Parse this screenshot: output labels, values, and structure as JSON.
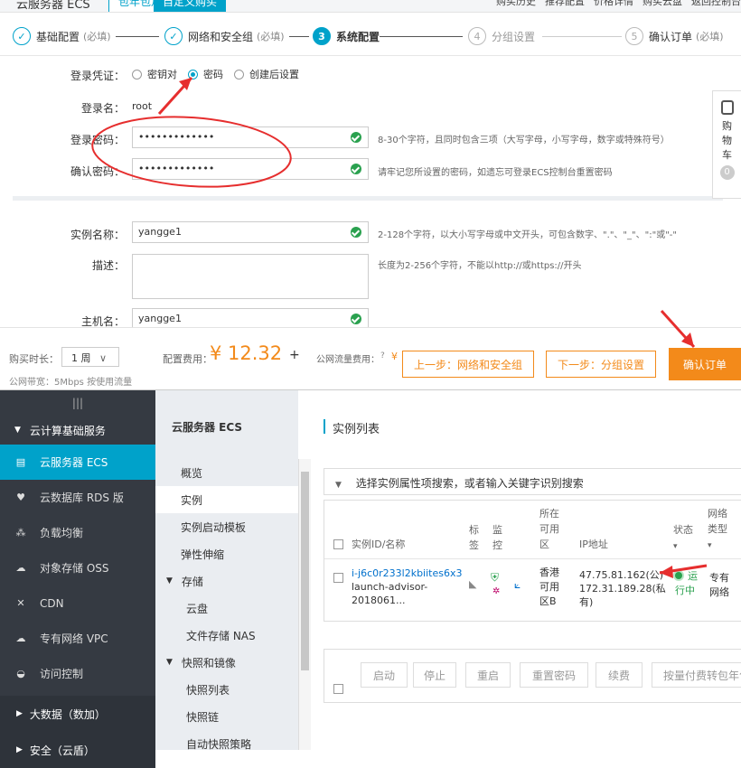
{
  "topbar": {
    "brand": "云服务器 ECS",
    "tabs": [
      "包年包月",
      "自定义购买"
    ],
    "nav": [
      "购买历史",
      "推荐配置",
      "价格详情",
      "购买云盘",
      "返回控制台"
    ]
  },
  "steps": [
    {
      "num": "✓",
      "label": "基础配置",
      "req": "(必填)"
    },
    {
      "num": "✓",
      "label": "网络和安全组",
      "req": "(必填)"
    },
    {
      "num": "3",
      "label": "系统配置",
      "req": ""
    },
    {
      "num": "4",
      "label": "分组设置",
      "req": ""
    },
    {
      "num": "5",
      "label": "确认订单",
      "req": "(必填)"
    }
  ],
  "form": {
    "credential_label": "登录凭证：",
    "credential_options": [
      "密钥对",
      "密码",
      "创建后设置"
    ],
    "username_label": "登录名：",
    "username_value": "root",
    "password_label": "登录密码：",
    "password_value": "•••••••••••••",
    "password_hint": "8-30个字符，且同时包含三项（大写字母，小写字母，数字或特殊符号）",
    "confirm_label": "确认密码：",
    "confirm_value": "•••••••••••••",
    "confirm_hint": "请牢记您所设置的密码，如遗忘可登录ECS控制台重置密码",
    "instance_label": "实例名称：",
    "instance_value": "yangge1",
    "instance_hint": "2-128个字符，以大小写字母或中文开头，可包含数字、\".\"、\"_\"、\":\"或\"-\"",
    "desc_label": "描述：",
    "desc_hint": "长度为2-256个字符，不能以http://或https://开头",
    "host_label": "主机名：",
    "host_value": "yangge1"
  },
  "cart": {
    "label": [
      "购",
      "物",
      "车"
    ],
    "count": "0"
  },
  "footer": {
    "duration_label": "购买时长：",
    "duration_value": "1 周",
    "bandwidth": "公网带宽：5Mbps 按使用流量",
    "fee_label": "配置费用：",
    "fee_value": "¥ 12.32",
    "plus": "+",
    "traffic_label": "公网流量费用：",
    "traffic_currency": "¥",
    "prev_btn": "上一步：网络和安全组",
    "next_btn": "下一步：分组设置",
    "confirm_btn": "确认订单"
  },
  "sidebar": {
    "group": "云计算基础服务",
    "items": [
      {
        "label": "云服务器 ECS",
        "icon": "server-icon"
      },
      {
        "label": "云数据库 RDS 版",
        "icon": "database-icon"
      },
      {
        "label": "负载均衡",
        "icon": "load-balancer-icon"
      },
      {
        "label": "对象存储 OSS",
        "icon": "cloud-storage-icon"
      },
      {
        "label": "CDN",
        "icon": "cdn-icon"
      },
      {
        "label": "专有网络 VPC",
        "icon": "vpc-icon"
      },
      {
        "label": "访问控制",
        "icon": "access-icon"
      }
    ],
    "sub_groups": [
      "大数据（数加）",
      "安全（云盾）"
    ]
  },
  "submenu": {
    "title": "云服务器 ECS",
    "items": [
      "概览",
      "实例",
      "实例启动模板",
      "弹性伸缩"
    ],
    "storage": "存储",
    "storage_items": [
      "云盘",
      "文件存储 NAS"
    ],
    "snapshot": "快照和镜像",
    "snapshot_items": [
      "快照列表",
      "快照链",
      "自动快照策略"
    ]
  },
  "main": {
    "title": "实例列表",
    "search_placeholder": "选择实例属性项搜索，或者输入关键字识别搜索",
    "headers": [
      "实例ID/名称",
      "标签",
      "监控",
      "所在可用区",
      "IP地址",
      "状态",
      "网络类型"
    ],
    "row": {
      "id": "i-j6c0r233l2kbiites6x3",
      "name": "launch-advisor-2018061...",
      "zone": "香港可用区B",
      "ip_public": "47.75.81.162(公)",
      "ip_private": "172.31.189.28(私有)",
      "status": "运行中",
      "network": "专有网络"
    },
    "ops": [
      "启动",
      "停止",
      "重启",
      "重置密码",
      "续费",
      "按量付费转包年包"
    ]
  }
}
